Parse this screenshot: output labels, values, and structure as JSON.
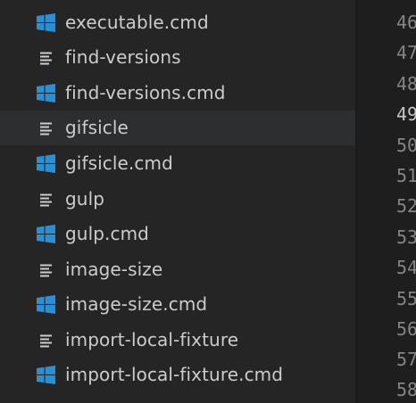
{
  "explorer": {
    "files": [
      {
        "name": "executable.cmd",
        "type": "cmd"
      },
      {
        "name": "find-versions",
        "type": "text"
      },
      {
        "name": "find-versions.cmd",
        "type": "cmd"
      },
      {
        "name": "gifsicle",
        "type": "text"
      },
      {
        "name": "gifsicle.cmd",
        "type": "cmd"
      },
      {
        "name": "gulp",
        "type": "text"
      },
      {
        "name": "gulp.cmd",
        "type": "cmd"
      },
      {
        "name": "image-size",
        "type": "text"
      },
      {
        "name": "image-size.cmd",
        "type": "cmd"
      },
      {
        "name": "import-local-fixture",
        "type": "text"
      },
      {
        "name": "import-local-fixture.cmd",
        "type": "cmd"
      }
    ],
    "selected_index": 3
  },
  "gutter": {
    "line_numbers": [
      "46",
      "47",
      "48",
      "49",
      "50",
      "51",
      "52",
      "53",
      "54",
      "55",
      "56",
      "57",
      "58"
    ],
    "active_line": "49"
  },
  "colors": {
    "windows_icon": "#2b8fd6",
    "text_icon": "#cccccc"
  }
}
